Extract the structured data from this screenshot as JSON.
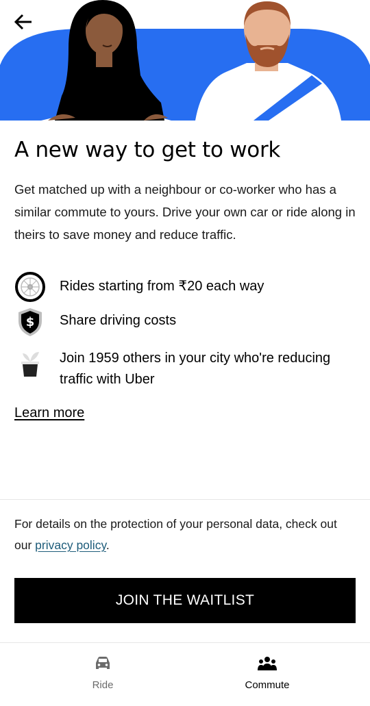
{
  "colors": {
    "accent": "#276EF1",
    "primary_button": "#000000",
    "link": "#1D5C7A",
    "inactive_tab": "#6B6B6B"
  },
  "header": {
    "back_icon": "arrow-left-icon"
  },
  "main": {
    "headline": "A new way to get to work",
    "intro": "Get matched up with a neighbour or co-worker who has a similar commute to yours. Drive your own car or ride along in theirs to save money and reduce traffic.",
    "features": [
      {
        "icon": "steering-wheel-icon",
        "text": "Rides starting from ₹20 each way"
      },
      {
        "icon": "dollar-shield-icon",
        "text": "Share driving costs"
      },
      {
        "icon": "plant-pot-icon",
        "text": "Join 1959 others in your city who're reducing traffic with Uber"
      }
    ],
    "learn_more": "Learn more"
  },
  "privacy": {
    "prefix": "For details on the protection of your personal data, check out our ",
    "link": "privacy policy",
    "suffix": "."
  },
  "cta": {
    "label": "JOIN THE WAITLIST"
  },
  "tabbar": {
    "tabs": [
      {
        "label": "Ride",
        "icon": "car-icon",
        "active": false
      },
      {
        "label": "Commute",
        "icon": "people-icon",
        "active": true
      }
    ]
  }
}
